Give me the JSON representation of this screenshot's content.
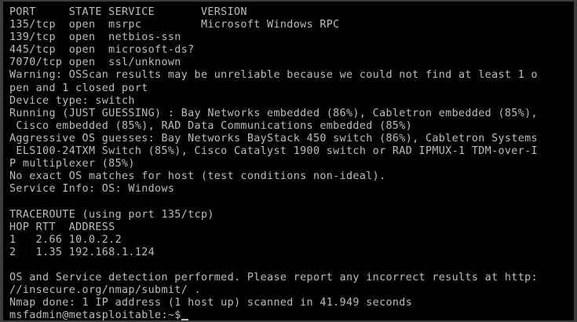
{
  "terminal": {
    "lines": [
      "PORT     STATE SERVICE       VERSION",
      "135/tcp  open  msrpc         Microsoft Windows RPC",
      "139/tcp  open  netbios-ssn",
      "445/tcp  open  microsoft-ds?",
      "7070/tcp open  ssl/unknown",
      "Warning: OSScan results may be unreliable because we could not find at least 1 o",
      "pen and 1 closed port",
      "Device type: switch",
      "Running (JUST GUESSING) : Bay Networks embedded (86%), Cabletron embedded (85%),",
      " Cisco embedded (85%), RAD Data Communications embedded (85%)",
      "Aggressive OS guesses: Bay Networks BayStack 450 switch (86%), Cabletron Systems",
      " ELS100-24TXM Switch (85%), Cisco Catalyst 1900 switch or RAD IPMUX-1 TDM-over-I",
      "P multiplexer (85%)",
      "No exact OS matches for host (test conditions non-ideal).",
      "Service Info: OS: Windows",
      "",
      "TRACEROUTE (using port 135/tcp)",
      "HOP RTT  ADDRESS",
      "1   2.66 10.0.2.2",
      "2   1.35 192.168.1.124",
      "",
      "OS and Service detection performed. Please report any incorrect results at http:",
      "//insecure.org/nmap/submit/ .",
      "Nmap done: 1 IP address (1 host up) scanned in 41.949 seconds"
    ],
    "prompt": "msfadmin@metasploitable:~$"
  },
  "colors": {
    "background": "#000000",
    "text": "#bdbdbd",
    "frame": "#3c3c3c"
  }
}
